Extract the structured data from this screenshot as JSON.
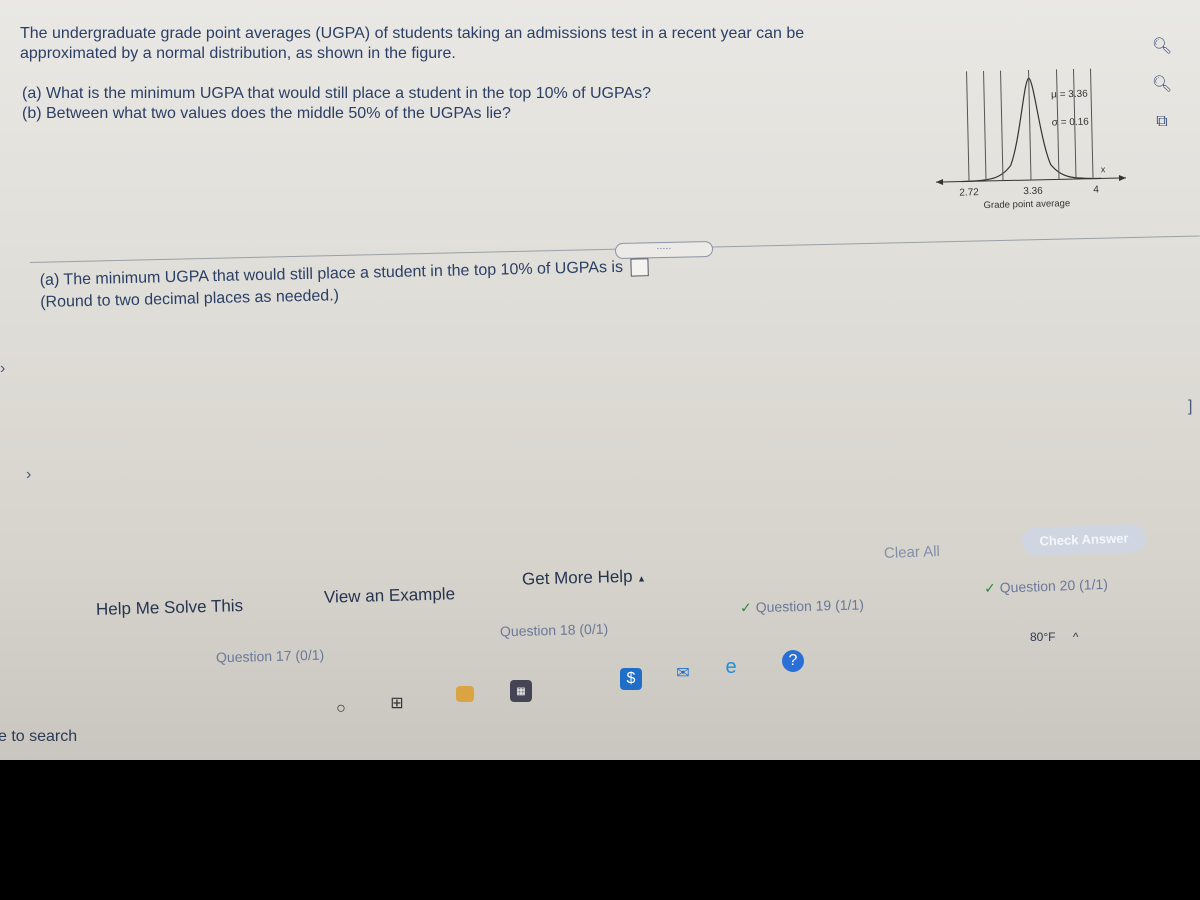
{
  "question": {
    "intro": "The undergraduate grade point averages (UGPA) of students taking an admissions test in a recent year can be approximated by a normal distribution, as shown in the figure.",
    "part_a": "(a) What is the minimum UGPA that would still place a student in the top 10% of UGPAs?",
    "part_b": "(b) Between what two values does the middle 50% of the UGPAs lie?"
  },
  "figure": {
    "mu_label": "μ = 3.36",
    "sigma_label": "σ = 0.16",
    "x_var": "x",
    "ticks": [
      "2.72",
      "3.36",
      "4"
    ],
    "axis_label": "Grade point average"
  },
  "expand_button": "·····",
  "answer": {
    "prompt": "(a) The minimum UGPA that would still place a student in the top 10% of UGPAs is",
    "value": "",
    "hint": "(Round to two decimal places as needed.)"
  },
  "side_icons": [
    "zoom-in-icon",
    "zoom-out-icon",
    "popout-icon"
  ],
  "actions": {
    "help": "Help Me Solve This",
    "example": "View an Example",
    "more_help": "Get More Help",
    "more_help_caret": "▲",
    "clear_all": "Clear All",
    "check_answer": "Check Answer"
  },
  "question_nav": {
    "q17": "Question 17 (0/1)",
    "q18": "Question 18 (0/1)",
    "q19": "Question 19 (1/1)",
    "q20": "Question 20 (1/1)",
    "check": "✓"
  },
  "taskbar": {
    "search": "e to search",
    "weather": "80°F"
  }
}
